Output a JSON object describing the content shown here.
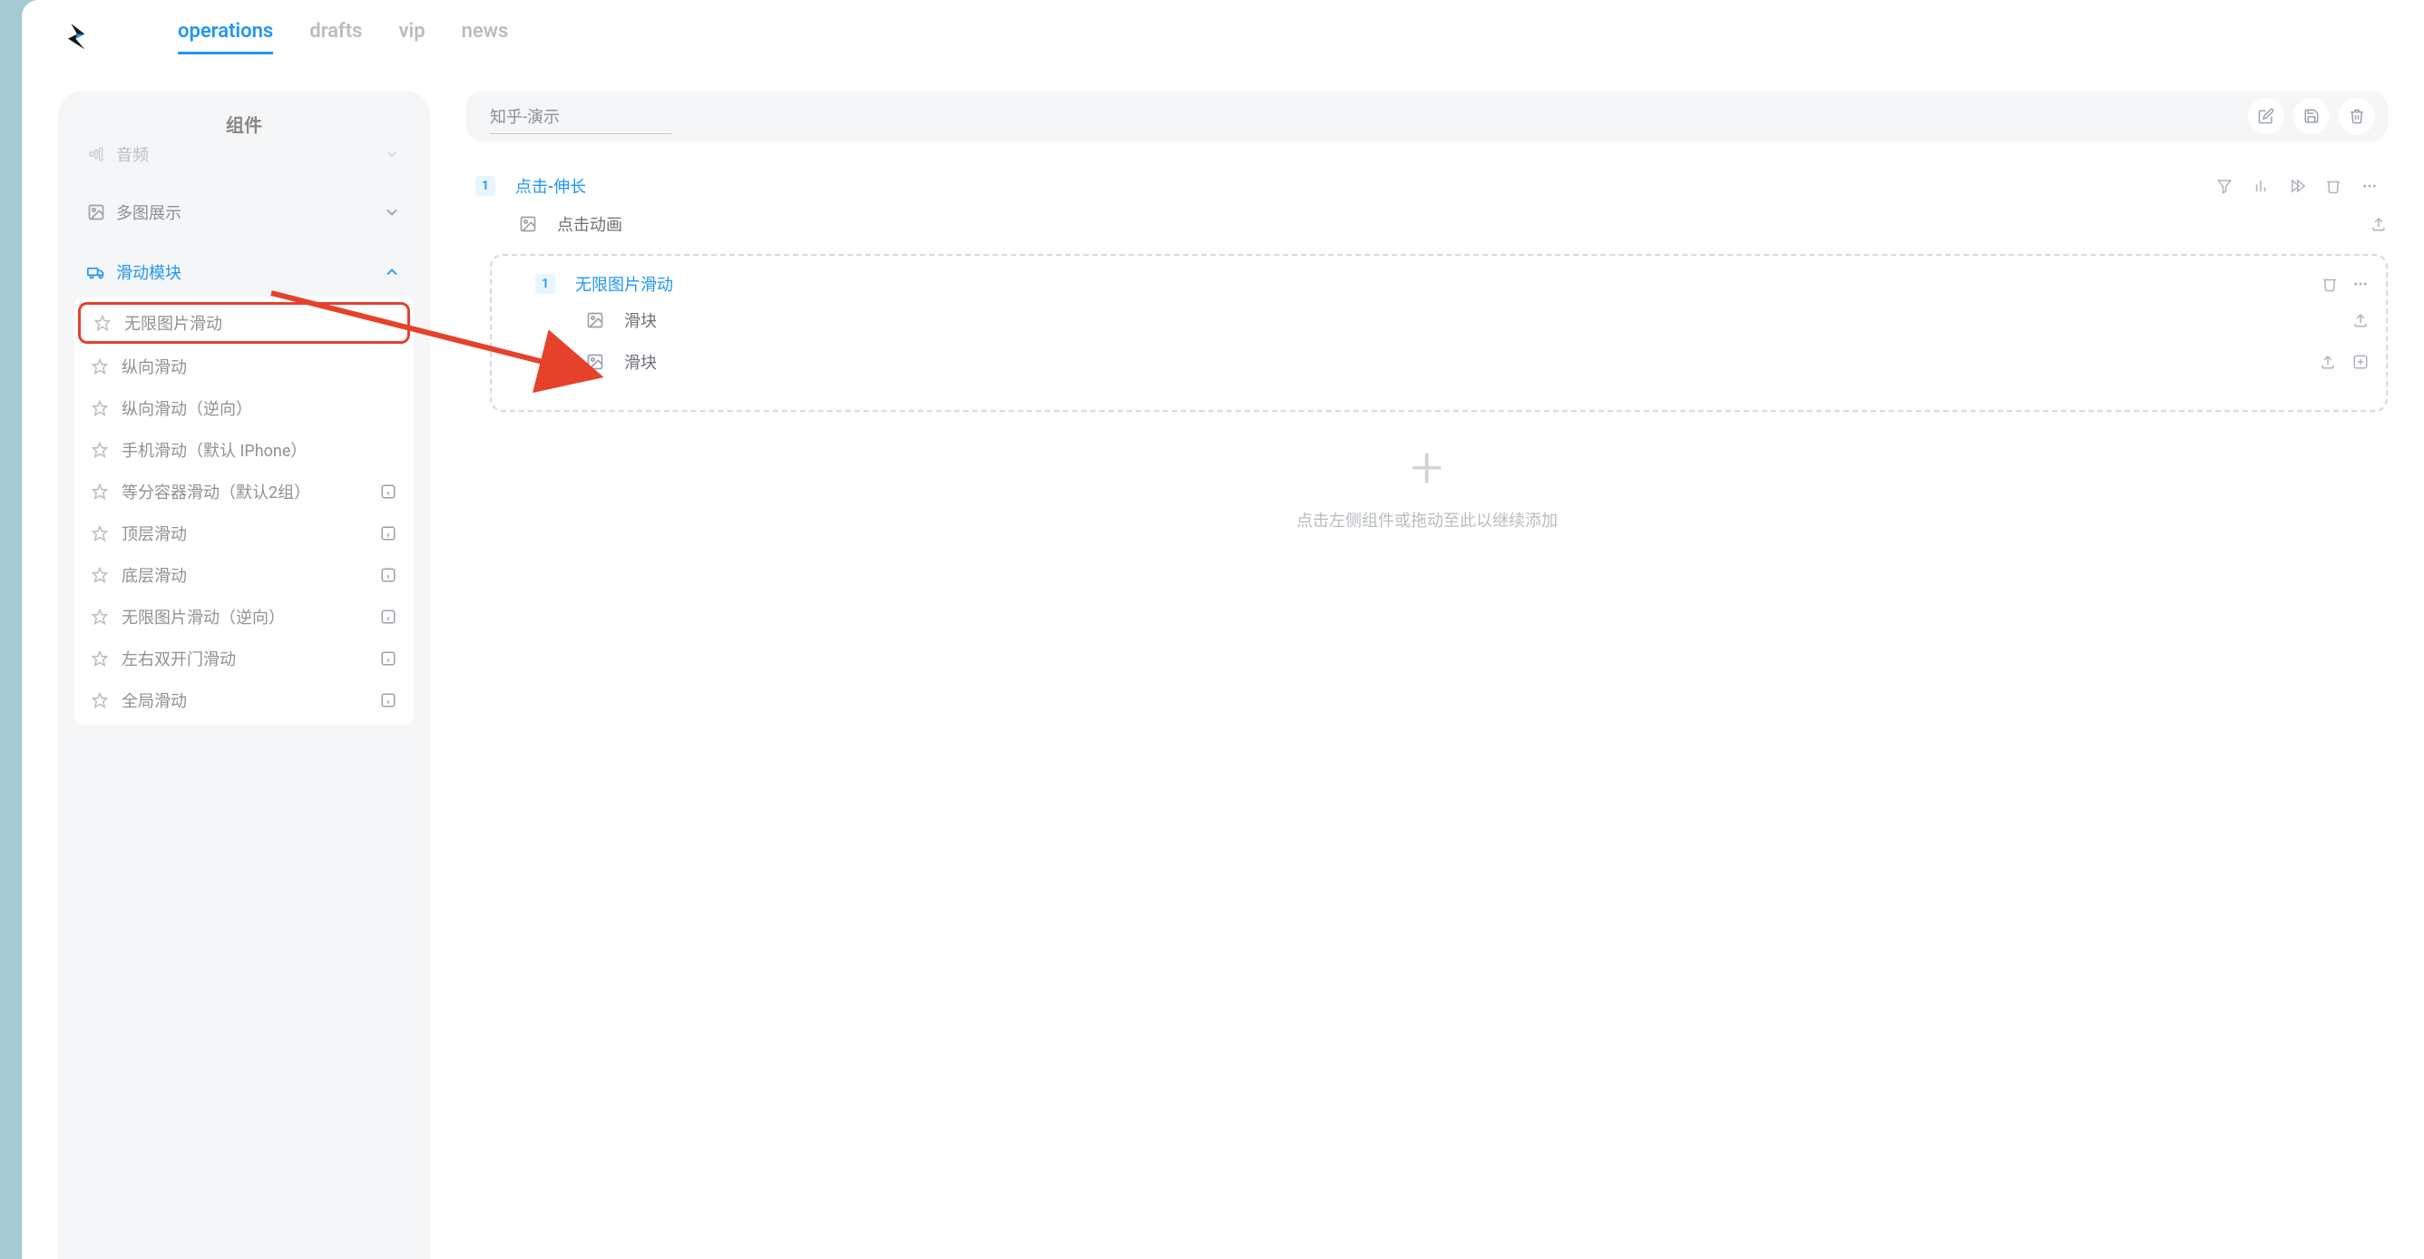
{
  "nav": {
    "tabs": [
      {
        "label": "operations",
        "active": true
      },
      {
        "label": "drafts",
        "active": false
      },
      {
        "label": "vip",
        "active": false
      },
      {
        "label": "news",
        "active": false
      }
    ]
  },
  "sidebar": {
    "title": "组件",
    "truncated_cat": "音频",
    "categories": [
      {
        "label": "多图展示",
        "expanded": false
      },
      {
        "label": "滑动模块",
        "expanded": true
      }
    ],
    "slide_items": [
      {
        "label": "无限图片滑动",
        "highlight": true,
        "info": false
      },
      {
        "label": "纵向滑动",
        "info": false
      },
      {
        "label": "纵向滑动（逆向）",
        "info": false
      },
      {
        "label": "手机滑动（默认 IPhone）",
        "info": false
      },
      {
        "label": "等分容器滑动（默认2组）",
        "info": true
      },
      {
        "label": "顶层滑动",
        "info": true
      },
      {
        "label": "底层滑动",
        "info": true
      },
      {
        "label": "无限图片滑动（逆向）",
        "info": true
      },
      {
        "label": "左右双开门滑动",
        "info": true
      },
      {
        "label": "全局滑动",
        "info": true
      }
    ]
  },
  "main": {
    "doc_title": "知乎-演示",
    "block": {
      "index": "1",
      "title": "点击-伸长",
      "anim_row": "点击动画",
      "inner": {
        "index": "1",
        "title": "无限图片滑动",
        "rows": [
          "滑块",
          "滑块"
        ]
      }
    },
    "drop_hint": "点击左侧组件或拖动至此以继续添加"
  }
}
